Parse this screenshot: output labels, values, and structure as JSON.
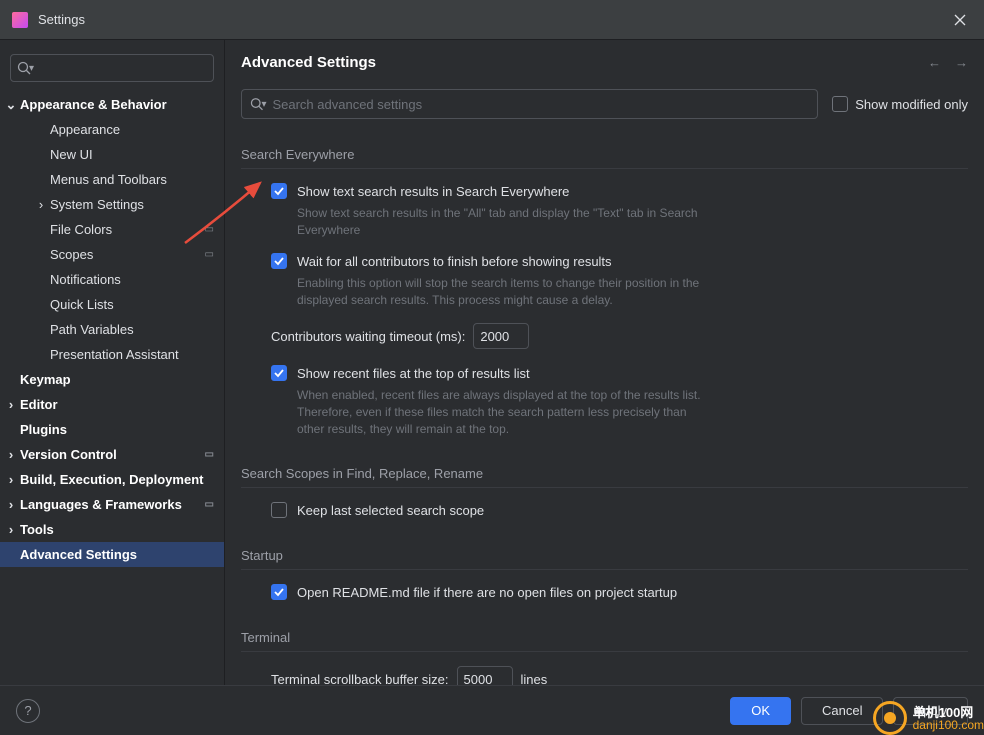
{
  "titlebar": {
    "title": "Settings"
  },
  "sidebar": {
    "search_placeholder": "",
    "items": [
      {
        "label": "Appearance & Behavior",
        "level": 0,
        "expanded": true,
        "arrow": true
      },
      {
        "label": "Appearance",
        "level": 1
      },
      {
        "label": "New UI",
        "level": 1
      },
      {
        "label": "Menus and Toolbars",
        "level": 1
      },
      {
        "label": "System Settings",
        "level": 1,
        "arrow": true
      },
      {
        "label": "File Colors",
        "level": 1,
        "badge": "▭"
      },
      {
        "label": "Scopes",
        "level": 1,
        "badge": "▭"
      },
      {
        "label": "Notifications",
        "level": 1
      },
      {
        "label": "Quick Lists",
        "level": 1
      },
      {
        "label": "Path Variables",
        "level": 1
      },
      {
        "label": "Presentation Assistant",
        "level": 1
      },
      {
        "label": "Keymap",
        "level": 0
      },
      {
        "label": "Editor",
        "level": 0,
        "arrow": true
      },
      {
        "label": "Plugins",
        "level": 0
      },
      {
        "label": "Version Control",
        "level": 0,
        "arrow": true,
        "badge": "▭"
      },
      {
        "label": "Build, Execution, Deployment",
        "level": 0,
        "arrow": true
      },
      {
        "label": "Languages & Frameworks",
        "level": 0,
        "arrow": true,
        "badge": "▭"
      },
      {
        "label": "Tools",
        "level": 0,
        "arrow": true
      },
      {
        "label": "Advanced Settings",
        "level": 0,
        "active": true
      }
    ]
  },
  "content": {
    "title": "Advanced Settings",
    "search_placeholder": "Search advanced settings",
    "show_modified_label": "Show modified only",
    "sections": {
      "search_everywhere": {
        "title": "Search Everywhere",
        "opt1_label": "Show text search results in Search Everywhere",
        "opt1_desc": "Show text search results in the \"All\" tab and display the \"Text\" tab in Search Everywhere",
        "opt2_label": "Wait for all contributors to finish before showing results",
        "opt2_desc": "Enabling this option will stop the search items to change their position in the displayed search results. This process might cause a delay.",
        "timeout_label": "Contributors waiting timeout (ms):",
        "timeout_value": "2000",
        "opt3_label": "Show recent files at the top of results list",
        "opt3_desc": "When enabled, recent files are always displayed at the top of the results list. Therefore, even if these files match the search pattern less precisely than other results, they will remain at the top."
      },
      "search_scopes": {
        "title": "Search Scopes in Find, Replace, Rename",
        "opt1_label": "Keep last selected search scope"
      },
      "startup": {
        "title": "Startup",
        "opt1_label": "Open README.md file if there are no open files on project startup"
      },
      "terminal": {
        "title": "Terminal",
        "buffer_label": "Terminal scrollback buffer size:",
        "buffer_value": "5000",
        "buffer_suffix": "lines"
      }
    }
  },
  "footer": {
    "ok": "OK",
    "cancel": "Cancel",
    "apply": "Apply"
  },
  "watermark": {
    "line1": "单机100网",
    "line2": "danji100.com"
  }
}
